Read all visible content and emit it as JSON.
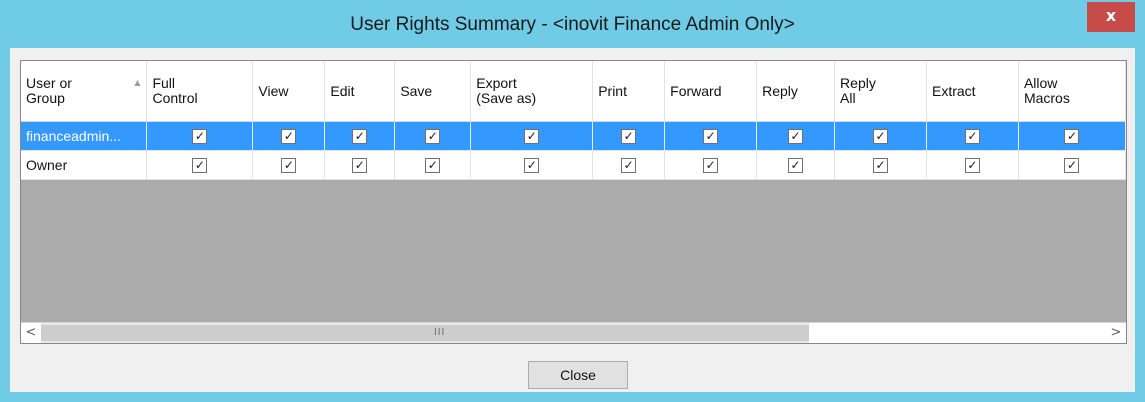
{
  "window": {
    "title": "User Rights Summary - <inovit Finance Admin Only>",
    "close_glyph": "x"
  },
  "table": {
    "columns": [
      "User or\nGroup",
      "Full\nControl",
      "View",
      "Edit",
      "Save",
      "Export\n(Save as)",
      "Print",
      "Forward",
      "Reply",
      "Reply\nAll",
      "Extract",
      "Allow\nMacros"
    ],
    "rows": [
      {
        "user": "financeadmin...",
        "selected": true,
        "rights": [
          true,
          true,
          true,
          true,
          true,
          true,
          true,
          true,
          true,
          true,
          true
        ]
      },
      {
        "user": "Owner",
        "selected": false,
        "rights": [
          true,
          true,
          true,
          true,
          true,
          true,
          true,
          true,
          true,
          true,
          true
        ]
      }
    ],
    "sort_indicator": "▲"
  },
  "scrollbar": {
    "left_arrow": "<",
    "right_arrow": ">",
    "grip": "III"
  },
  "footer": {
    "close_label": "Close"
  },
  "colors": {
    "title_bar": "#6fcbe6",
    "close_x": "#c74b48",
    "selection": "#3399ff",
    "grid_empty": "#ababab"
  }
}
